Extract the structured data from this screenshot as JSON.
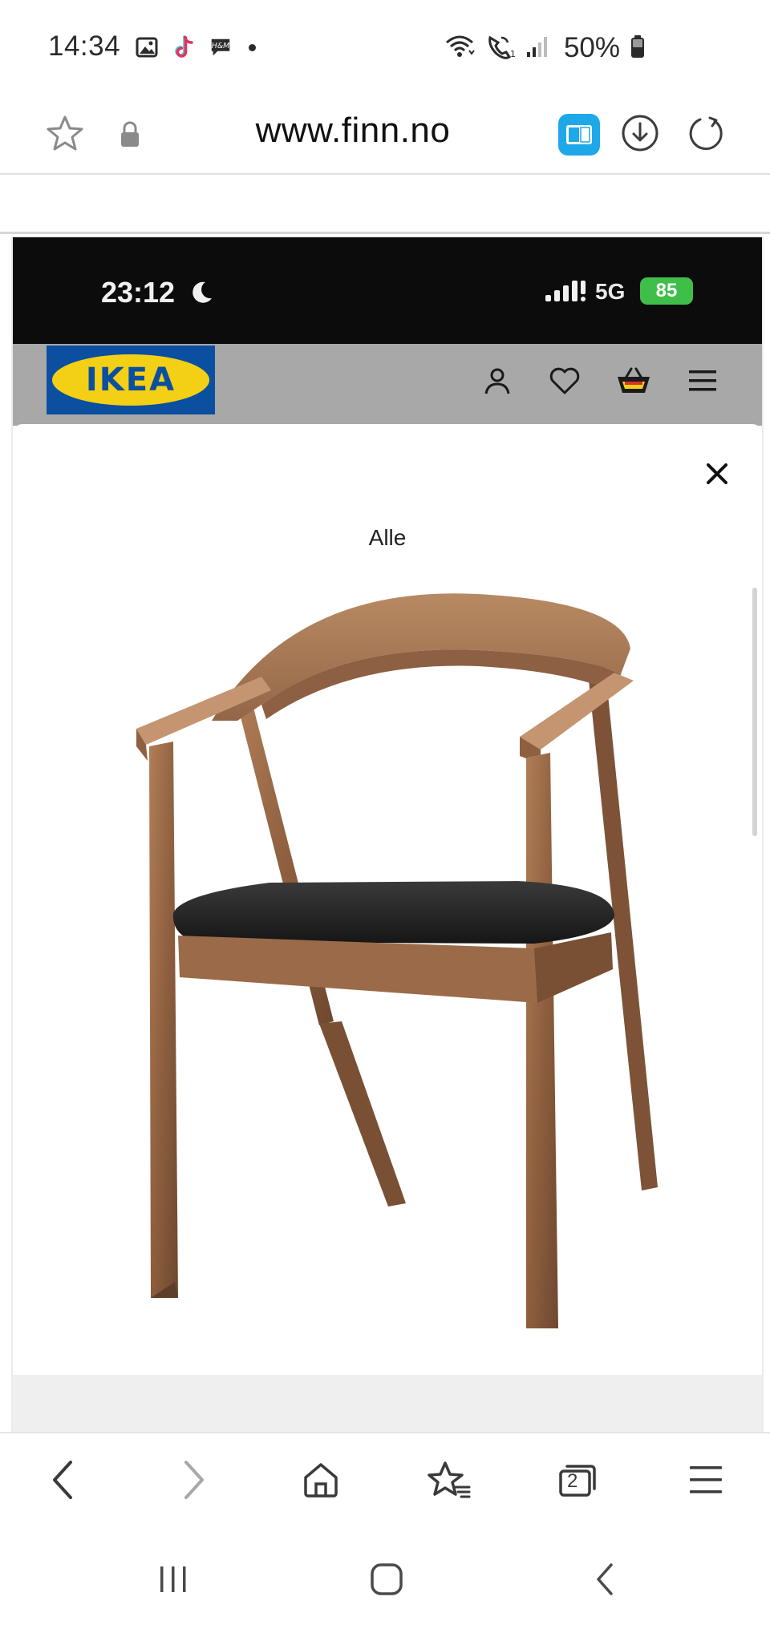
{
  "status_bar": {
    "time": "14:34",
    "battery": "50%",
    "notification_icons": [
      "gallery-icon",
      "tiktok-icon",
      "hm-icon",
      "more-dot"
    ],
    "system_icons": [
      "wifi-icon",
      "wifi-call-icon",
      "signal-icon",
      "battery-icon"
    ]
  },
  "browser": {
    "url": "www.finn.no",
    "reader_accent": "#1fa8e8"
  },
  "screenshot": {
    "status_time": "23:12",
    "network": "5G",
    "battery": "85",
    "battery_color": "#3fbf4a",
    "ikea": {
      "logo_text": "IKEA",
      "logo_blue": "#0a4fa0",
      "logo_yellow": "#f3cf16",
      "nav_icons": [
        "account-icon",
        "wishlist-heart-icon",
        "basket-icon",
        "menu-icon"
      ]
    },
    "modal": {
      "tab_label": "Alle",
      "close_icon": "close-icon",
      "image_subject": "chair-image"
    }
  },
  "bottom_nav": {
    "tab_count": "2",
    "icons": [
      "back-icon",
      "forward-icon",
      "home-icon",
      "bookmarks-icon",
      "tabs-icon",
      "menu-icon"
    ]
  },
  "system_nav": {
    "icons": [
      "recents-icon",
      "home-button-icon",
      "system-back-icon"
    ]
  }
}
